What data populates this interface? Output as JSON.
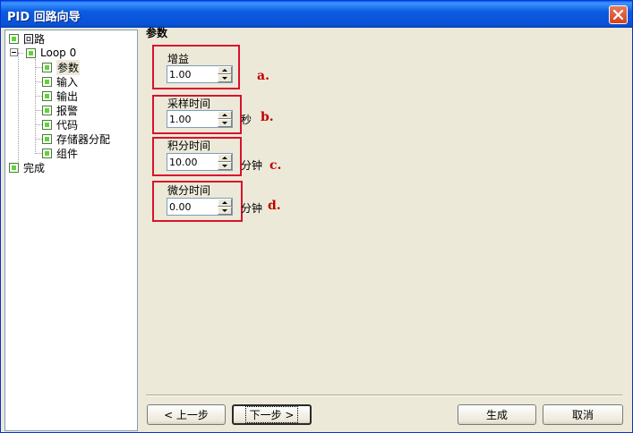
{
  "window": {
    "title": "PID 回路向导"
  },
  "colors": {
    "titlebar": "#0a52d6",
    "node": "#5fd33b",
    "annotation": "#c00000",
    "highlight_box": "#d9112d"
  },
  "tree": {
    "items": [
      {
        "label": "回路",
        "icon": "tree-node-icon"
      },
      {
        "label": "Loop 0",
        "icon": "tree-node-icon",
        "expanded": true
      },
      {
        "label": "参数",
        "icon": "tree-node-icon",
        "selected": true
      },
      {
        "label": "输入",
        "icon": "tree-node-icon"
      },
      {
        "label": "输出",
        "icon": "tree-node-icon"
      },
      {
        "label": "报警",
        "icon": "tree-node-icon"
      },
      {
        "label": "代码",
        "icon": "tree-node-icon"
      },
      {
        "label": "存储器分配",
        "icon": "tree-node-icon"
      },
      {
        "label": "组件",
        "icon": "tree-node-icon"
      },
      {
        "label": "完成",
        "icon": "tree-node-icon"
      }
    ]
  },
  "main": {
    "section_title": "参数",
    "params": [
      {
        "label": "增益",
        "value": "1.00",
        "unit": "",
        "annotation": "a."
      },
      {
        "label": "采样时间",
        "value": "1.00",
        "unit": "秒",
        "annotation": "b."
      },
      {
        "label": "积分时间",
        "value": "10.00",
        "unit": "分钟",
        "annotation": "c."
      },
      {
        "label": "微分时间",
        "value": "0.00",
        "unit": "分钟",
        "annotation": "d."
      }
    ]
  },
  "buttons": {
    "prev": "< 上一步",
    "next": "下一步 >",
    "generate": "生成",
    "cancel": "取消"
  }
}
